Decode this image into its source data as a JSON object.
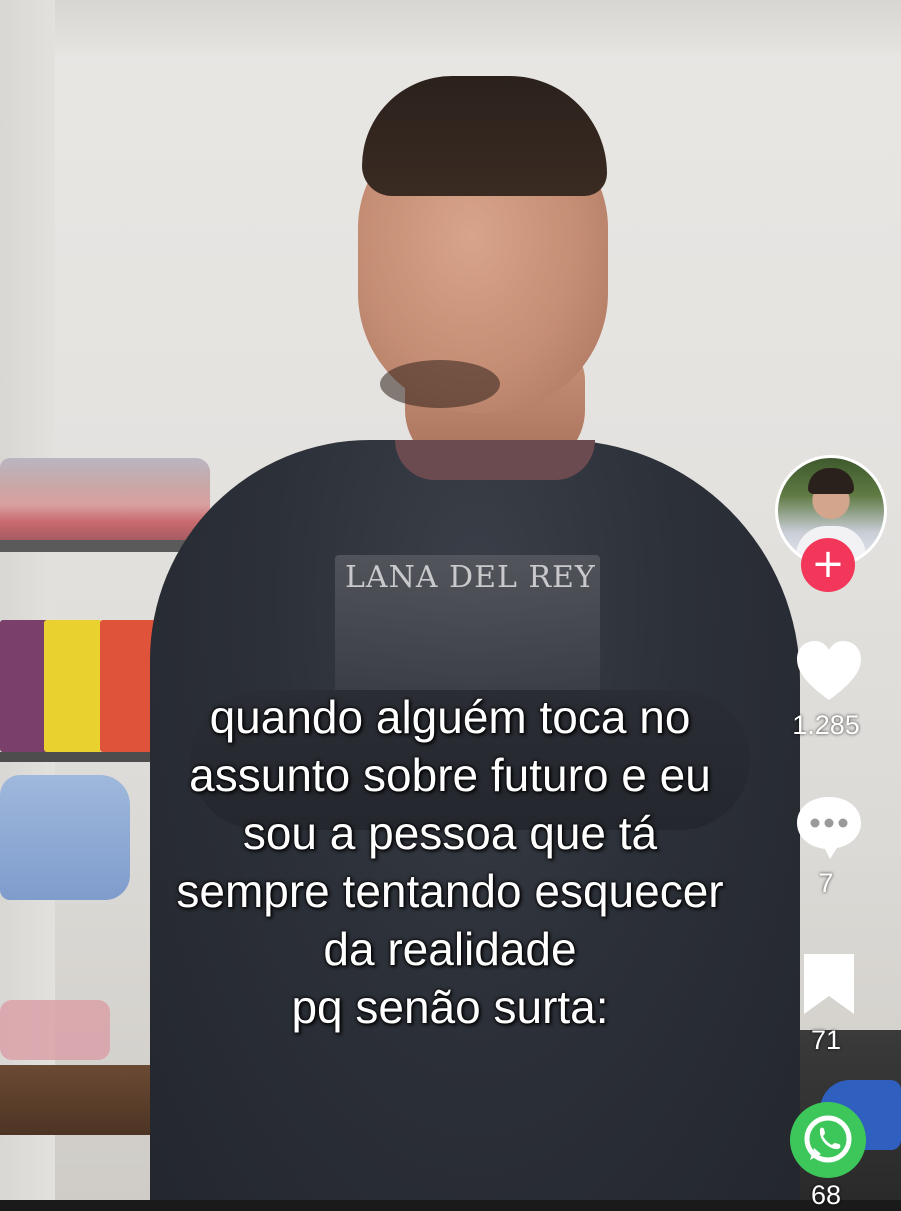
{
  "caption": {
    "lines": [
      "quando alguém toca no",
      "assunto sobre futuro e eu",
      "sou a pessoa que tá",
      "sempre tentando esquecer",
      "da realidade",
      "pq senão surta:"
    ]
  },
  "shirt_print": "LANA DEL REY",
  "actions": {
    "follow_label": "+",
    "likes": "1.285",
    "comments": "7",
    "saves": "71",
    "shares": "68"
  },
  "icons": {
    "like": "heart-icon",
    "comment": "comment-bubble-icon",
    "save": "bookmark-icon",
    "share": "whatsapp-icon",
    "follow": "plus-icon"
  },
  "colors": {
    "follow_badge": "#f2375a",
    "whatsapp": "#3dc75a",
    "icon": "#ffffff"
  }
}
